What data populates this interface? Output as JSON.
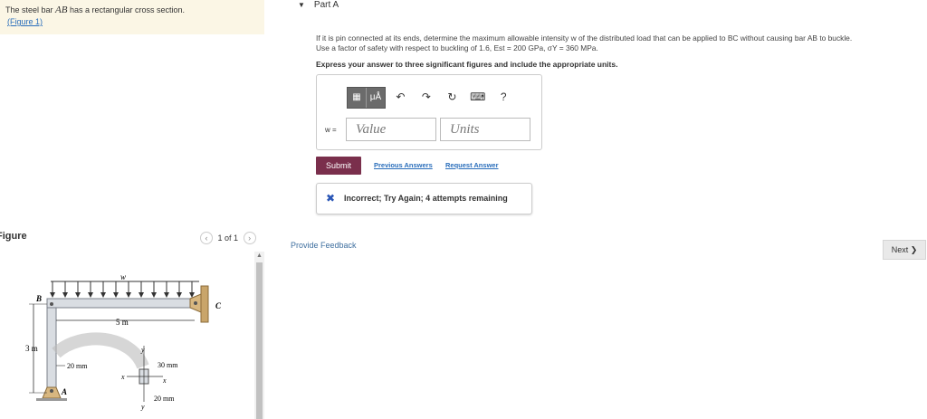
{
  "intro": {
    "text_before": "The steel bar ",
    "bar_name": "AB",
    "text_after": " has a rectangular cross section.",
    "figure_link": "(Figure 1)"
  },
  "figure_panel": {
    "title": "Figure",
    "pager_text": "1 of 1",
    "prev_icon": "chevron-left-icon",
    "next_icon": "chevron-right-icon"
  },
  "figure_labels": {
    "w": "w",
    "B": "B",
    "C": "C",
    "A": "A",
    "span": "5 m",
    "height": "3 m",
    "width_side": "20 mm",
    "section_height": "30 mm",
    "section_width": "20 mm",
    "axis_x": "x",
    "axis_y": "y"
  },
  "part": {
    "title": "Part A",
    "problem_line1": "If it is pin connected at its ends, determine the maximum allowable intensity w of the distributed load that can be applied to BC without causing bar AB to buckle.",
    "problem_line2": "Use a factor of safety with respect to buckling of 1.6, Est = 200 GPa, σY = 360 MPa.",
    "instruction": "Express your answer to three significant figures and include the appropriate units."
  },
  "answer": {
    "variable_label": "w =",
    "value_placeholder": "Value",
    "units_placeholder": "Units",
    "toolbar_units_glyph": "μÅ",
    "help_glyph": "?"
  },
  "actions": {
    "submit_label": "Submit",
    "previous_answers_label": "Previous Answers",
    "request_answer_label": "Request Answer"
  },
  "feedback": {
    "message": "Incorrect; Try Again; 4 attempts remaining",
    "provide_feedback": "Provide Feedback",
    "next_label": "Next"
  },
  "colors": {
    "submit_bg": "#7a2f4c",
    "link": "#2a6ebb",
    "error_x": "#2a56b6",
    "intro_bg": "#fbf6e5"
  }
}
